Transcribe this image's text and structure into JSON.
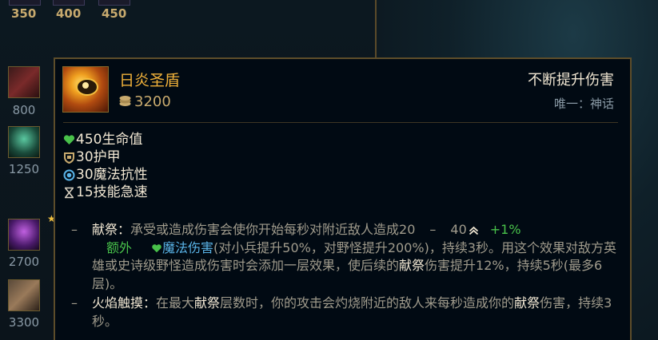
{
  "shop": {
    "top_prices": [
      "350",
      "400",
      "450"
    ],
    "side_prices": [
      "800",
      "1250",
      "2700",
      "3300"
    ]
  },
  "tooltip": {
    "item_name": "日炎圣盾",
    "cost": "3200",
    "tag": "不断提升伤害",
    "unique": "唯一：神话",
    "stats": [
      {
        "icon": "health-icon",
        "text": "450生命值"
      },
      {
        "icon": "armor-icon",
        "text": "30护甲"
      },
      {
        "icon": "magic-resist-icon",
        "text": "30魔法抗性"
      },
      {
        "icon": "ability-haste-icon",
        "text": "15技能急速"
      }
    ],
    "passive1": {
      "dash": "–",
      "name": "献祭：",
      "text_a": "承受或造成伤害会使你开始每秒对附近敌人造成20",
      "range_dash": "–",
      "range_max": "40",
      "bonus": "+1%",
      "extra": "额外",
      "dmg_type": "魔法伤害",
      "text_b": "(对小兵提升50%，对野怪提升200%)，持续3秒。用这个效果对敌方英雄或史诗级野怪造成伤害时会添加一层效果，使后续的",
      "kw": "献祭",
      "text_c": "伤害提升12%，持续5秒(最多6层)。"
    },
    "passive2": {
      "dash": "–",
      "name": "火焰触摸：",
      "text_a": "在最大",
      "kw1": "献祭",
      "text_b": "层数时，你的攻击会灼烧附近的敌人来每秒造成你的",
      "kw2": "献祭",
      "text_c": "伤害，持续3秒。"
    }
  },
  "colors": {
    "gold": "#c8aa6e",
    "name": "#f0b13a",
    "green": "#48c14a",
    "border": "#5d4d2a"
  }
}
